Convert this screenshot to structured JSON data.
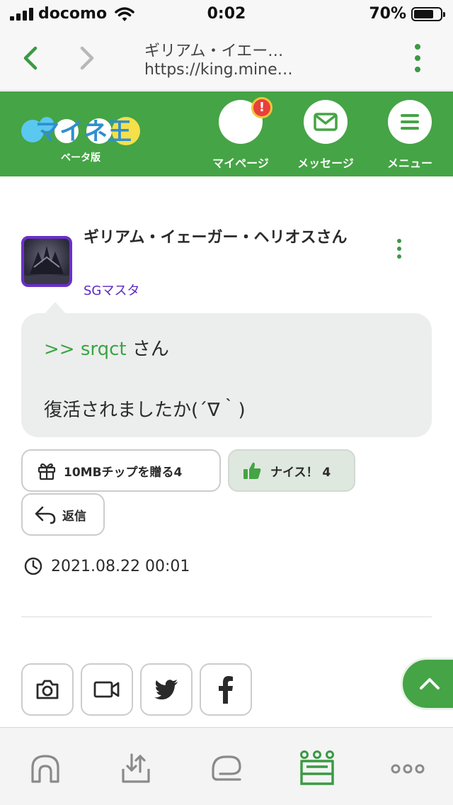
{
  "status_bar": {
    "carrier": "docomo",
    "time": "0:02",
    "battery_percent": "70%",
    "battery_level": 0.7
  },
  "browser": {
    "page_title": "ギリアム・イエー…",
    "url": "https://king.mine…",
    "back_icon": "chevron-left-icon",
    "forward_icon": "chevron-right-icon",
    "menu_icon": "more-vertical-icon"
  },
  "header": {
    "logo_text": "マイネ王",
    "logo_sub": "ベータ版",
    "items": [
      {
        "label": "マイページ",
        "icon": "avatar",
        "badge": "!"
      },
      {
        "label": "メッセージ",
        "icon": "envelope-icon"
      },
      {
        "label": "メニュー",
        "icon": "hamburger-icon"
      }
    ]
  },
  "post": {
    "author_name": "ギリアム・イェーガー・ヘリオスさん",
    "author_rank": "SGマスタ",
    "reply_to": ">> srqct",
    "reply_suffix": "さん",
    "body": "復活されましたか(´∇｀)",
    "gift_button": "10MBチップを贈る4",
    "nice_button": "ナイス！ 4",
    "reply_button": "返信",
    "timestamp": "2021.08.22 00:01"
  },
  "share": {
    "buttons": [
      "camera-icon",
      "video-icon",
      "twitter-icon",
      "facebook-icon"
    ]
  },
  "tab_bar": {
    "tabs": [
      "home-icon",
      "upload-icon",
      "chat-icon",
      "crown-icon",
      "more-icon"
    ],
    "active": "crown-icon"
  },
  "colors": {
    "brand_green": "#45a445",
    "rank_purple": "#5a28c0",
    "mention_green": "#3da444",
    "badge_red": "#e8403a"
  }
}
